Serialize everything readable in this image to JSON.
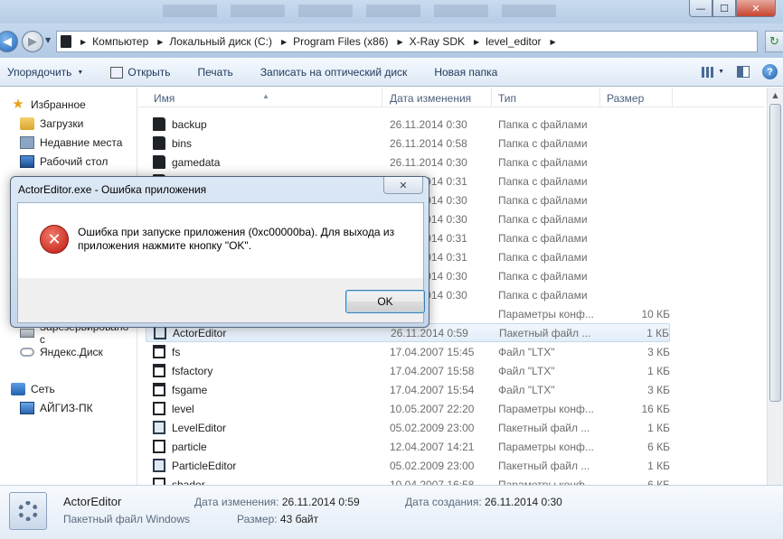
{
  "window": {
    "minimize_glyph": "—",
    "maximize_glyph": "☐",
    "close_glyph": "✕"
  },
  "address": {
    "crumbs": [
      "Компьютер",
      "Локальный диск (C:)",
      "Program Files (x86)",
      "X-Ray SDK",
      "level_editor"
    ]
  },
  "toolbar": {
    "organize": "Упорядочить",
    "open": "Открыть",
    "print": "Печать",
    "burn": "Записать на оптический диск",
    "new_folder": "Новая папка"
  },
  "sidebar": {
    "favorites": "Избранное",
    "downloads": "Загрузки",
    "recent": "Недавние места",
    "desktop": "Рабочий стол",
    "reserved": "Зарезервировано с",
    "yandex": "Яндекс.Диск",
    "network": "Сеть",
    "pc": "АЙГИЗ-ПК"
  },
  "columns": {
    "name": "Имя",
    "date": "Дата изменения",
    "type": "Тип",
    "size": "Размер"
  },
  "files": [
    {
      "name": "backup",
      "date": "26.11.2014 0:30",
      "type": "Папка с файлами",
      "size": "",
      "kind": "folder"
    },
    {
      "name": "bins",
      "date": "26.11.2014 0:58",
      "type": "Папка с файлами",
      "size": "",
      "kind": "folder"
    },
    {
      "name": "gamedata",
      "date": "26.11.2014 0:30",
      "type": "Папка с файлами",
      "size": "",
      "kind": "folder"
    },
    {
      "name": "",
      "date": "26.11.2014 0:31",
      "type": "Папка с файлами",
      "size": "",
      "kind": "folder"
    },
    {
      "name": "",
      "date": "26.11.2014 0:30",
      "type": "Папка с файлами",
      "size": "",
      "kind": "folder"
    },
    {
      "name": "",
      "date": "26.11.2014 0:30",
      "type": "Папка с файлами",
      "size": "",
      "kind": "folder"
    },
    {
      "name": "",
      "date": "26.11.2014 0:31",
      "type": "Папка с файлами",
      "size": "",
      "kind": "folder"
    },
    {
      "name": "",
      "date": "26.11.2014 0:31",
      "type": "Папка с файлами",
      "size": "",
      "kind": "folder"
    },
    {
      "name": "",
      "date": "26.11.2014 0:30",
      "type": "Папка с файлами",
      "size": "",
      "kind": "folder"
    },
    {
      "name": "",
      "date": "26.11.2014 0:30",
      "type": "Папка с файлами",
      "size": "",
      "kind": "folder"
    },
    {
      "name": "",
      "date": "7 17:08",
      "type": "Параметры конф...",
      "size": "10 КБ",
      "kind": "cfg"
    },
    {
      "name": "ActorEditor",
      "date": "26.11.2014 0:59",
      "type": "Пакетный файл ...",
      "size": "1 КБ",
      "kind": "bat"
    },
    {
      "name": "fs",
      "date": "17.04.2007 15:45",
      "type": "Файл \"LTX\"",
      "size": "3 КБ",
      "kind": "ltx"
    },
    {
      "name": "fsfactory",
      "date": "17.04.2007 15:58",
      "type": "Файл \"LTX\"",
      "size": "1 КБ",
      "kind": "ltx"
    },
    {
      "name": "fsgame",
      "date": "17.04.2007 15:54",
      "type": "Файл \"LTX\"",
      "size": "3 КБ",
      "kind": "ltx"
    },
    {
      "name": "level",
      "date": "10.05.2007 22:20",
      "type": "Параметры конф...",
      "size": "16 КБ",
      "kind": "cfg"
    },
    {
      "name": "LevelEditor",
      "date": "05.02.2009 23:00",
      "type": "Пакетный файл ...",
      "size": "1 КБ",
      "kind": "bat"
    },
    {
      "name": "particle",
      "date": "12.04.2007 14:21",
      "type": "Параметры конф...",
      "size": "6 КБ",
      "kind": "cfg"
    },
    {
      "name": "ParticleEditor",
      "date": "05.02.2009 23:00",
      "type": "Пакетный файл ...",
      "size": "1 КБ",
      "kind": "bat"
    },
    {
      "name": "shader",
      "date": "10.04.2007 16:58",
      "type": "Параметры конф...",
      "size": "6 КБ",
      "kind": "cfg"
    }
  ],
  "selected_row": 11,
  "details": {
    "name": "ActorEditor",
    "type": "Пакетный файл Windows",
    "modified_label": "Дата изменения:",
    "modified_value": "26.11.2014 0:59",
    "size_label": "Размер:",
    "size_value": "43 байт",
    "created_label": "Дата создания:",
    "created_value": "26.11.2014 0:30"
  },
  "dialog": {
    "title": "ActorEditor.exe - Ошибка приложения",
    "close_glyph": "✕",
    "error_glyph": "✕",
    "message": "Ошибка при запуске приложения (0xc00000ba). Для выхода из приложения нажмите кнопку \"OK\".",
    "ok_label": "OK"
  }
}
